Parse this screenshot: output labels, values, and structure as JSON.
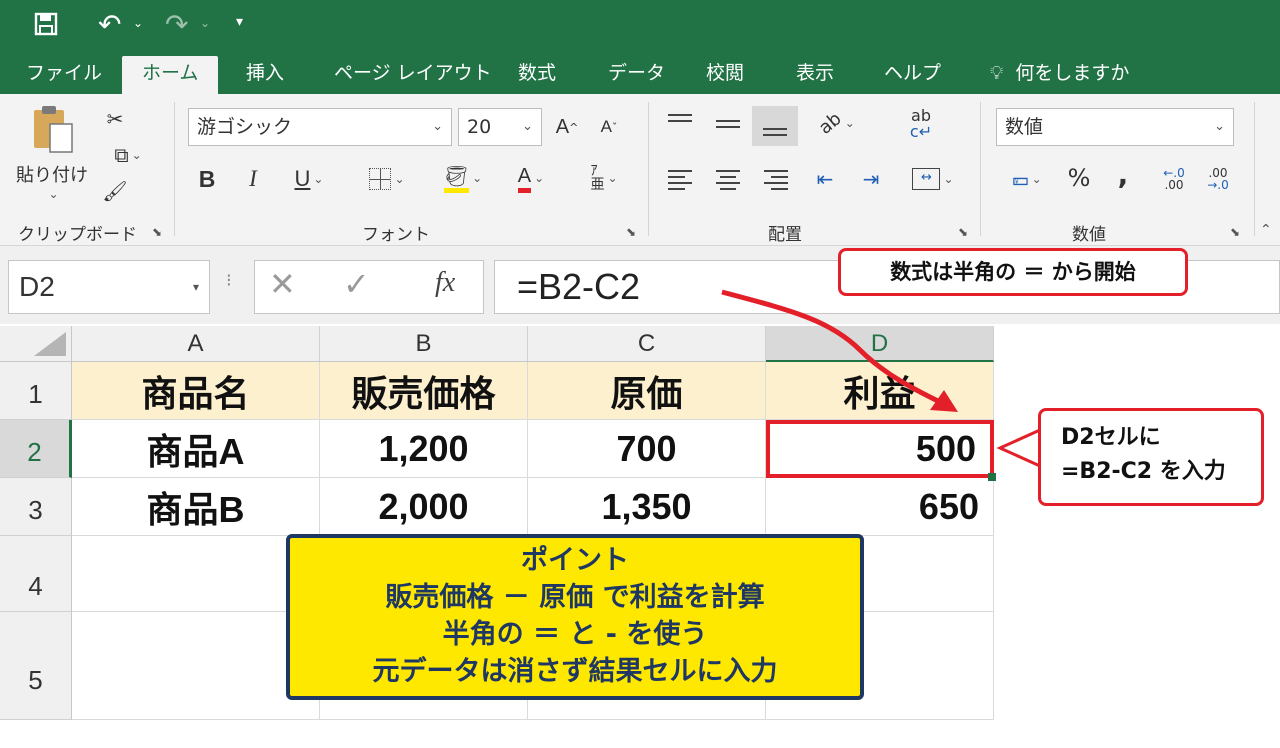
{
  "quick_access": {
    "save_icon": "save-icon",
    "undo_icon": "undo-icon",
    "redo_icon": "redo-icon",
    "customize_icon": "customize-icon"
  },
  "tabs": [
    {
      "label": "ファイル"
    },
    {
      "label": "ホーム",
      "active": true
    },
    {
      "label": "挿入"
    },
    {
      "label": "ページ レイアウト"
    },
    {
      "label": "数式"
    },
    {
      "label": "データ"
    },
    {
      "label": "校閲"
    },
    {
      "label": "表示"
    },
    {
      "label": "ヘルプ"
    }
  ],
  "tell_me": "何をしますか",
  "ribbon": {
    "clipboard": {
      "paste_label": "貼り付け",
      "group_label": "クリップボード"
    },
    "font": {
      "font_name": "游ゴシック",
      "font_size": "20",
      "group_label": "フォント",
      "bold": "B",
      "italic": "I",
      "underline": "U",
      "font_color_glyph": "A",
      "grow": "A",
      "shrink": "A"
    },
    "alignment": {
      "group_label": "配置",
      "wrap_glyph": "ab"
    },
    "number": {
      "format": "数値",
      "group_label": "数値",
      "percent": "%",
      "comma": ",",
      "inc_decimal": ".00",
      "dec_decimal": ".00"
    }
  },
  "formula_bar": {
    "name_box": "D2",
    "fx": "fx",
    "formula": "=B2-C2"
  },
  "sheet": {
    "columns": [
      "A",
      "B",
      "C",
      "D"
    ],
    "rows": [
      "1",
      "2",
      "3",
      "4",
      "5"
    ],
    "selected_column": "D",
    "selected_row": "2",
    "cells": {
      "A1": "商品名",
      "B1": "販売価格",
      "C1": "原価",
      "D1": "利益",
      "A2": "商品A",
      "B2": "1,200",
      "C2": "700",
      "D2": "500",
      "A3": "商品B",
      "B3": "2,000",
      "C3": "1,350",
      "D3": "650"
    }
  },
  "callouts": {
    "formula_note": "数式は半角の ＝ から開始",
    "cell_note_line1": "D2セルに",
    "cell_note_line2": "=B2-C2 を入力",
    "accent_color": "#e3202a"
  },
  "point_box": {
    "title": "ポイント",
    "line1": "販売価格 － 原価 で利益を計算",
    "line2": "半角の ＝ と - を使う",
    "line3": "元データは消さず結果セルに入力",
    "bg_color": "#ffe800",
    "border_color": "#1f3763"
  },
  "colors": {
    "brand": "#217346",
    "header_fill": "#fdf0cf"
  }
}
